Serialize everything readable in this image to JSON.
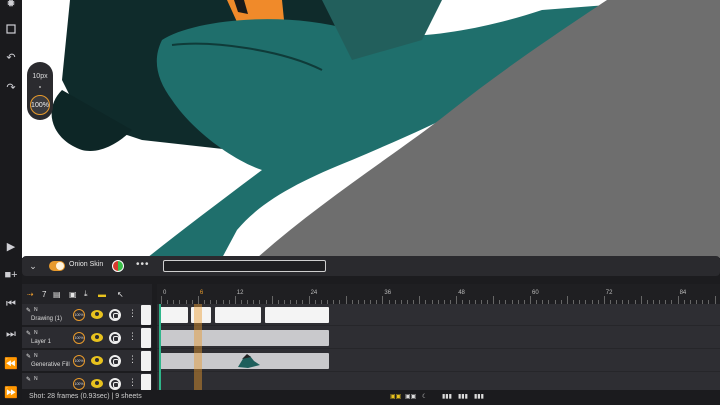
{
  "left_rail": {
    "icons": [
      "select-dots-icon",
      "selection-square-icon",
      "undo-icon",
      "redo-icon",
      "play-icon",
      "add-frame-icon",
      "skip-start-icon",
      "step-forward-icon",
      "rewind-icon",
      "fast-forward-icon"
    ]
  },
  "brush": {
    "size": "10px",
    "opacity": "100%"
  },
  "timeline_toolbar": {
    "onion_skin_label": "Onion Skin",
    "onion_skin_enabled": true,
    "field_value": ""
  },
  "layer_header": {
    "frame_count": "7"
  },
  "ruler": {
    "labels": [
      "0",
      "6",
      "12",
      "24",
      "36",
      "48",
      "60",
      "72",
      "84"
    ]
  },
  "layers": [
    {
      "number": "N",
      "name": "Drawing (1)",
      "opacity": "100%"
    },
    {
      "number": "N",
      "name": "Layer 1",
      "opacity": "100%"
    },
    {
      "number": "N",
      "name": "Generative Fill",
      "opacity": "100%"
    },
    {
      "number": "N",
      "name": "",
      "opacity": "100%"
    }
  ],
  "status": {
    "text": "Shot: 28 frames (0.93sec) | 9 sheets"
  },
  "colors": {
    "accent": "#e89a2c",
    "teal": "#1f6f6c",
    "panel": "#2a2a2e"
  }
}
